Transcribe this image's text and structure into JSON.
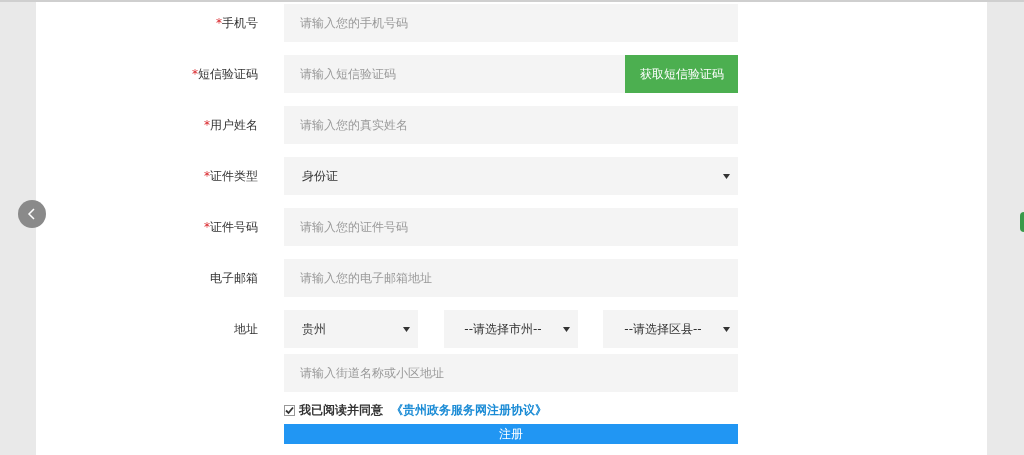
{
  "form": {
    "fields": [
      {
        "kind": "text",
        "required_mark": "*",
        "label": "手机号",
        "placeholder": "请输入您的手机号码"
      },
      {
        "kind": "sms",
        "required_mark": "*",
        "label": "短信验证码",
        "placeholder": "请输入短信验证码",
        "button": "获取短信验证码"
      },
      {
        "kind": "text",
        "required_mark": "*",
        "label": "用户姓名",
        "placeholder": "请输入您的真实姓名"
      },
      {
        "kind": "select",
        "required_mark": "*",
        "label": "证件类型",
        "value": "身份证"
      },
      {
        "kind": "text",
        "required_mark": "*",
        "label": "证件号码",
        "placeholder": "请输入您的证件号码"
      },
      {
        "kind": "text",
        "label": "电子邮箱",
        "placeholder": "请输入您的电子邮箱地址"
      }
    ],
    "address": {
      "label": "地址",
      "selects": [
        {
          "value": "贵州"
        },
        {
          "value": "--请选择市州--"
        },
        {
          "value": "--请选择区县--"
        }
      ],
      "street_placeholder": "请输入街道名称或小区地址"
    },
    "agreement": {
      "checked": true,
      "text": "我已阅读并同意",
      "link": "《贵州政务服务网注册协议》"
    },
    "submit": "注册"
  }
}
